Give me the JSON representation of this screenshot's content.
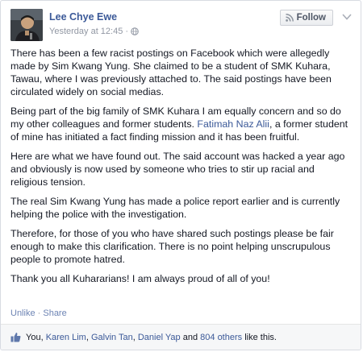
{
  "post": {
    "author": "Lee Chye Ewe",
    "timestamp": "Yesterday at 12:45",
    "separator": "·",
    "follow_label": "Follow",
    "paragraphs": {
      "p1": "There has been a few racist postings on Facebook which were allegedly made by Sim Kwang Yung. She claimed to be a student of SMK Kuhara, Tawau, where I was previously attached to. The said postings have been circulated widely on social medias.",
      "p2_before": "Being part of the big family of SMK Kuhara I am equally concern and so do my other colleagues and former students. ",
      "p2_link": "Fatimah Naz Alii",
      "p2_after": ", a former student of mine has initiated a fact finding mission and it has been fruitful.",
      "p3": "Here are what we have found out. The said account was hacked a year ago and obviously is now used by someone who tries to stir up racial and religious tension.",
      "p4": "The real Sim Kwang Yung has made a police report earlier and is currently helping the police with the investigation.",
      "p5": "Therefore, for those of you who have shared such postings please be fair enough to make this clarification. There is no point helping unscrupulous people to promote hatred.",
      "p6": "Thank you all Kuhararians! I am always proud of all of you!"
    },
    "actions": {
      "unlike": "Unlike",
      "dot": " · ",
      "share": "Share"
    },
    "likes": {
      "you": "You,",
      "people": [
        "Karen Lim",
        "Galvin Tan",
        "Daniel Yap"
      ],
      "comma": ",",
      "and": "and",
      "others": "804 others",
      "suffix": "like this."
    },
    "icons": {
      "globe": "globe-icon",
      "rss": "rss-icon",
      "chevron": "chevron-down-icon",
      "thumb": "thumbs-up-icon"
    },
    "colors": {
      "link": "#3b5998",
      "meta": "#9197a3",
      "text": "#141823"
    }
  }
}
